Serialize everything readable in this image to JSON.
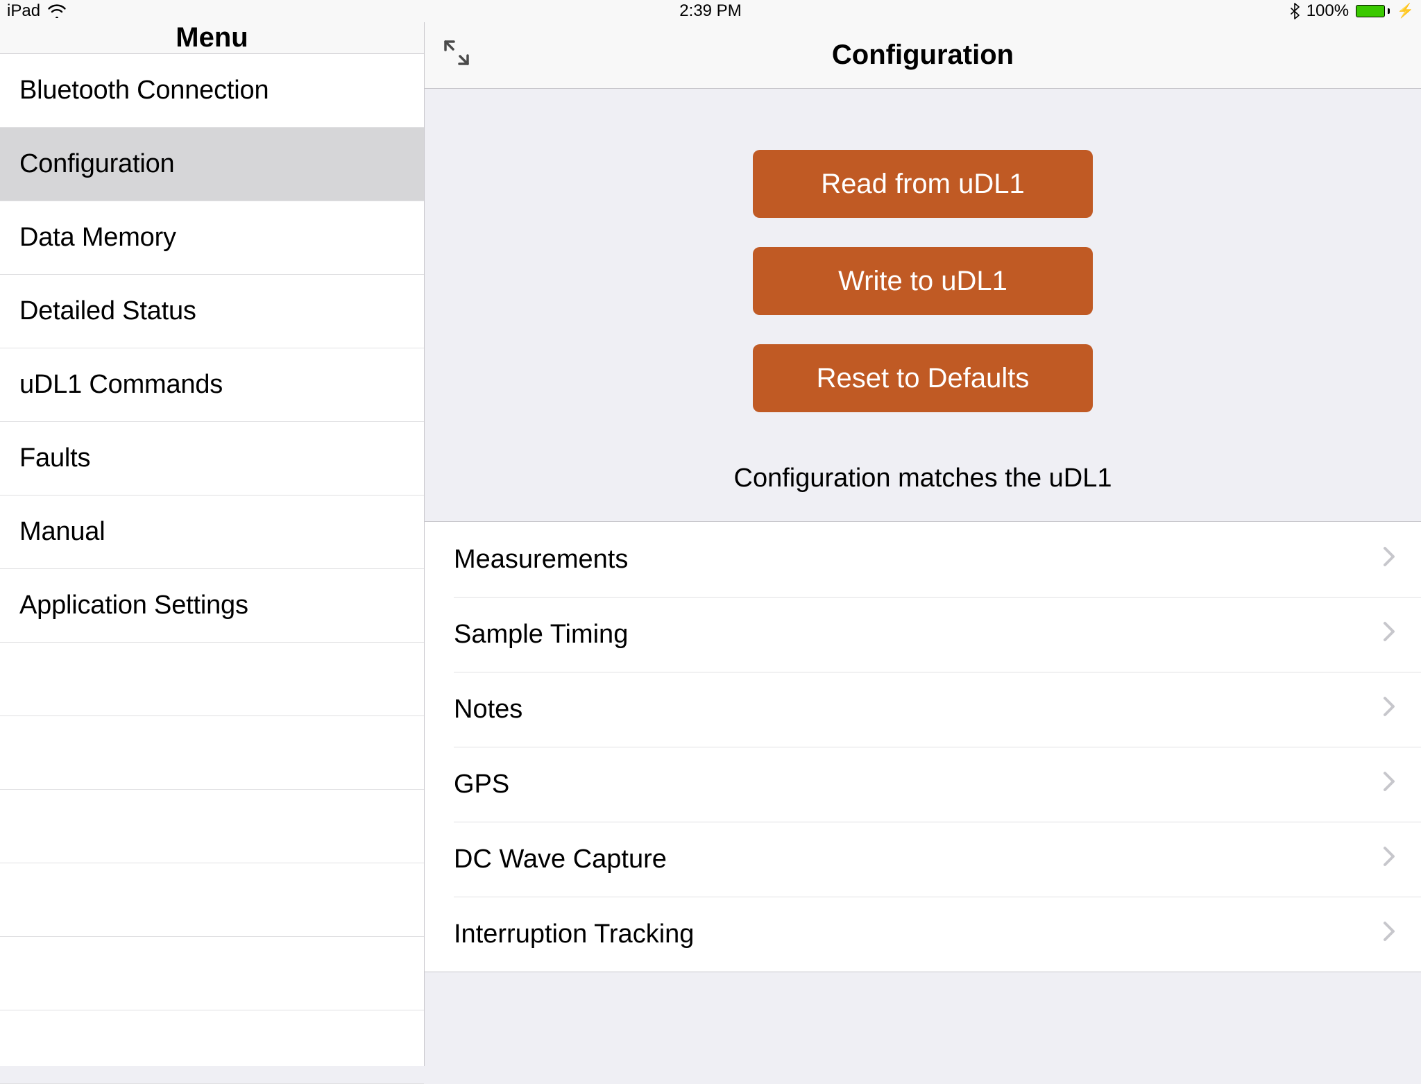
{
  "statusbar": {
    "device": "iPad",
    "time": "2:39 PM",
    "battery_pct": "100%"
  },
  "sidebar": {
    "title": "Menu",
    "items": [
      {
        "label": "Bluetooth Connection"
      },
      {
        "label": "Configuration"
      },
      {
        "label": "Data Memory"
      },
      {
        "label": "Detailed Status"
      },
      {
        "label": "uDL1 Commands"
      },
      {
        "label": "Faults"
      },
      {
        "label": "Manual"
      },
      {
        "label": "Application Settings"
      }
    ],
    "selected_index": 1
  },
  "main": {
    "title": "Configuration",
    "buttons": {
      "read": "Read from uDL1",
      "write": "Write to uDL1",
      "reset": "Reset to Defaults"
    },
    "status_text": "Configuration matches the uDL1",
    "rows": [
      {
        "label": "Measurements"
      },
      {
        "label": "Sample Timing"
      },
      {
        "label": "Notes"
      },
      {
        "label": "GPS"
      },
      {
        "label": "DC Wave Capture"
      },
      {
        "label": "Interruption Tracking"
      }
    ]
  },
  "colors": {
    "accent": "#c05a24",
    "battery_fill": "#3ac900"
  }
}
